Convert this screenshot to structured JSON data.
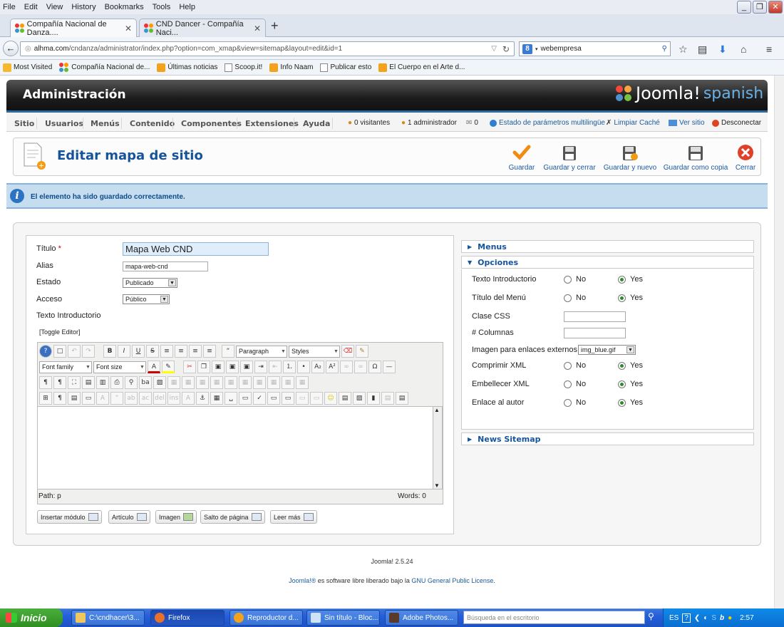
{
  "browser": {
    "menu": [
      "File",
      "Edit",
      "View",
      "History",
      "Bookmarks",
      "Tools",
      "Help"
    ],
    "tabs": [
      {
        "label": "Compañía Nacional de Danza...."
      },
      {
        "label": "CND Dancer - Compañía Naci..."
      }
    ],
    "url_host": "alhma.com",
    "url_path": "/cndanza/administrator/index.php?option=com_xmap&view=sitemap&layout=edit&id=1",
    "search_value": "webempresa",
    "bookmarks": [
      "Most Visited",
      "Compañía Nacional de...",
      "Últimas noticias",
      "Scoop.it!",
      "Info Naam",
      "Publicar esto",
      "El Cuerpo en el Arte d..."
    ]
  },
  "admin": {
    "title": "Administración",
    "logo_word": "Joomla!",
    "logo_lang": "spanish",
    "menu": [
      "Sitio",
      "Usuarios",
      "Menús",
      "Contenido",
      "Componentes",
      "Extensiones",
      "Ayuda"
    ],
    "status": {
      "visitors": "0 visitantes",
      "admins": "1 administrador",
      "messages": "0",
      "multilang": "Estado de parámetros multilingüe",
      "cache": "Limpiar Caché",
      "view_site": "Ver sitio",
      "logout": "Desconectar"
    }
  },
  "toolbar": {
    "title": "Editar mapa de sitio",
    "save": "Guardar",
    "save_close": "Guardar y cerrar",
    "save_new": "Guardar y nuevo",
    "save_copy": "Guardar como copia",
    "close": "Cerrar"
  },
  "message": "El elemento ha sido guardado correctamente.",
  "form": {
    "title_label": "Título",
    "title_required": "*",
    "title_value": "Mapa Web CND",
    "alias_label": "Alias",
    "alias_value": "mapa-web-cnd",
    "state_label": "Estado",
    "state_value": "Publicado",
    "access_label": "Acceso",
    "access_value": "Público",
    "intro_label": "Texto Introductorio",
    "toggle_editor": "[Toggle Editor]",
    "editor": {
      "paragraph": "Paragraph",
      "styles": "Styles",
      "font_family": "Font family",
      "font_size": "Font size",
      "path": "Path:  p",
      "words": "Words: 0"
    },
    "buttons": {
      "insert_module": "Insertar módulo",
      "article": "Artículo",
      "image": "Imagen",
      "page_break": "Salto de página",
      "read_more": "Leer más"
    }
  },
  "panels": {
    "menus": "Menus",
    "options": "Opciones",
    "news": "News Sitemap",
    "no": "No",
    "yes": "Yes",
    "rows": [
      {
        "label": "Texto Introductorio",
        "type": "radio",
        "value": "Yes"
      },
      {
        "label": "Título del Menú",
        "type": "radio",
        "value": "Yes"
      },
      {
        "label": "Clase CSS",
        "type": "text",
        "value": ""
      },
      {
        "label": "# Columnas",
        "type": "text",
        "value": ""
      },
      {
        "label": "Imagen para enlaces externos",
        "type": "select",
        "value": "img_blue.gif"
      },
      {
        "label": "Comprimir XML",
        "type": "radio",
        "value": "Yes"
      },
      {
        "label": "Embellecer XML",
        "type": "radio",
        "value": "Yes"
      },
      {
        "label": "Enlace al autor",
        "type": "radio",
        "value": "Yes"
      }
    ]
  },
  "footer": {
    "version": "Joomla! 2.5.24",
    "license_brand": "Joomla!®",
    "license_mid": " es software libre liberado bajo la ",
    "license_link": "GNU General Public License",
    "license_end": "."
  },
  "taskbar": {
    "start": "Inicio",
    "tasks": [
      "C:\\cndhacer\\3...",
      "Firefox",
      "Reproductor d...",
      "Sin título - Bloc...",
      "Adobe Photos..."
    ],
    "search_placeholder": "Búsqueda en el escritorio",
    "lang": "ES",
    "clock": "2:57"
  },
  "colors": {
    "accent": "#16549a",
    "header": "#1c1c1c",
    "message_bg": "#c6dcef"
  }
}
